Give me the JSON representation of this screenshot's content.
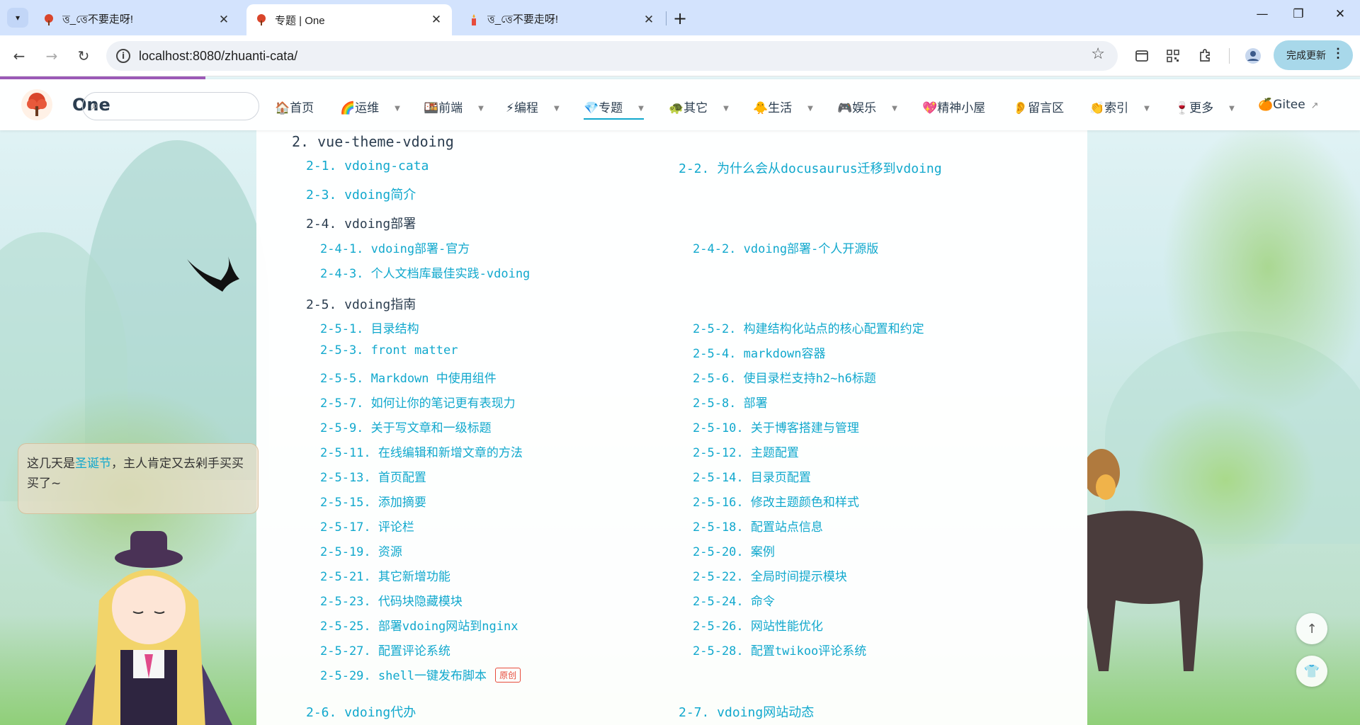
{
  "browser": {
    "tabs": [
      {
        "title": "ত্ত_ত্তে不要走呀!",
        "active": false
      },
      {
        "title": "专题 | One",
        "active": true
      },
      {
        "title": "ত্ত_ত্তে不要走呀!",
        "active": false
      }
    ],
    "url": "localhost:8080/zhuanti-cata/",
    "update_label": "完成更新"
  },
  "site": {
    "name": "One",
    "nav": [
      {
        "icon": "🏠",
        "label": "首页",
        "dropdown": false
      },
      {
        "icon": "🌈",
        "label": "运维",
        "dropdown": true
      },
      {
        "icon": "🍱",
        "label": "前端",
        "dropdown": true
      },
      {
        "icon": "⚡",
        "label": "编程",
        "dropdown": true
      },
      {
        "icon": "💎",
        "label": "专题",
        "dropdown": true,
        "active": true
      },
      {
        "icon": "🐢",
        "label": "其它",
        "dropdown": true
      },
      {
        "icon": "🐥",
        "label": "生活",
        "dropdown": true
      },
      {
        "icon": "🎮",
        "label": "娱乐",
        "dropdown": true
      },
      {
        "icon": "💖",
        "label": "精神小屋",
        "dropdown": false
      },
      {
        "icon": "👂",
        "label": "留言区",
        "dropdown": false
      },
      {
        "icon": "👏",
        "label": "索引",
        "dropdown": true
      },
      {
        "icon": "🍷",
        "label": "更多",
        "dropdown": true
      },
      {
        "icon": "🍊",
        "label": "Gitee",
        "dropdown": false,
        "external": true
      }
    ]
  },
  "content": {
    "section": "2. vue-theme-vdoing",
    "links_top": [
      "2-1. vdoing-cata",
      "2-2. 为什么会从docusaurus迁移到vdoing",
      "2-3. vdoing简介"
    ],
    "deploy": {
      "title": "2-4. vdoing部署",
      "items": [
        "2-4-1. vdoing部署-官方",
        "2-4-2. vdoing部署-个人开源版",
        "2-4-3. 个人文档库最佳实践-vdoing"
      ]
    },
    "guide": {
      "title": "2-5. vdoing指南",
      "items": [
        "2-5-1. 目录结构",
        "2-5-2. 构建结构化站点的核心配置和约定",
        "2-5-3. front matter",
        "2-5-4. markdown容器",
        "2-5-5. Markdown 中使用组件",
        "2-5-6. 使目录栏支持h2~h6标题",
        "2-5-7. 如何让你的笔记更有表现力",
        "2-5-8. 部署",
        "2-5-9. 关于写文章和一级标题",
        "2-5-10. 关于博客搭建与管理",
        "2-5-11. 在线编辑和新增文章的方法",
        "2-5-12. 主题配置",
        "2-5-13. 首页配置",
        "2-5-14. 目录页配置",
        "2-5-15. 添加摘要",
        "2-5-16. 修改主题颜色和样式",
        "2-5-17. 评论栏",
        "2-5-18. 配置站点信息",
        "2-5-19. 资源",
        "2-5-20. 案例",
        "2-5-21. 其它新增功能",
        "2-5-22. 全局时间提示模块",
        "2-5-23. 代码块隐藏模块",
        "2-5-24. 命令",
        "2-5-25. 部署vdoing网站到nginx",
        "2-5-26. 网站性能优化",
        "2-5-27. 配置评论系统",
        "2-5-28. 配置twikoo评论系统",
        "2-5-29. shell一键发布脚本"
      ],
      "badge": "原创"
    },
    "links_bottom": [
      "2-6. vdoing代办",
      "2-7. vdoing网站动态"
    ]
  },
  "widget": {
    "msg_before": "这几天是",
    "msg_highlight": "圣诞节",
    "msg_after": "，主人肯定又去剁手买买买了~"
  },
  "icons": {
    "back": "back-arrow-icon",
    "forward": "forward-arrow-icon",
    "reload": "reload-icon",
    "star": "bookmark-star-icon",
    "totop": "arrow-up-icon",
    "theme": "shirt-icon"
  }
}
